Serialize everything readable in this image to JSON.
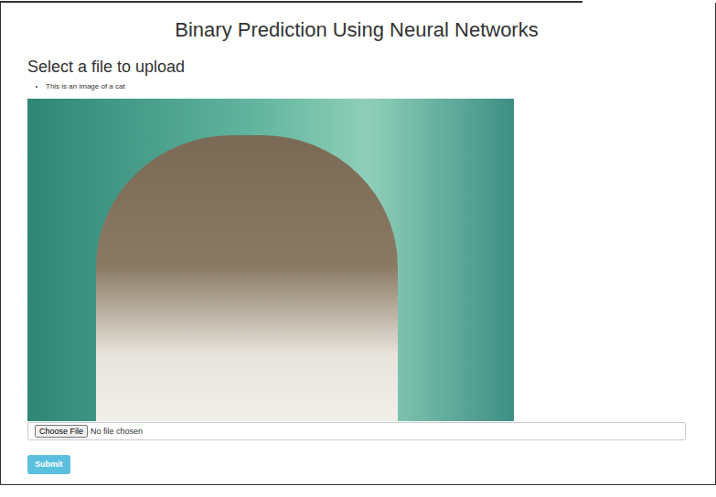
{
  "page": {
    "title": "Binary Prediction Using Neural Networks"
  },
  "upload": {
    "heading": "Select a file to upload",
    "notes": [
      "This is an image of a cat"
    ],
    "file_input": {
      "button": "Choose File",
      "status": "No file chosen"
    },
    "submit": "Submit"
  }
}
